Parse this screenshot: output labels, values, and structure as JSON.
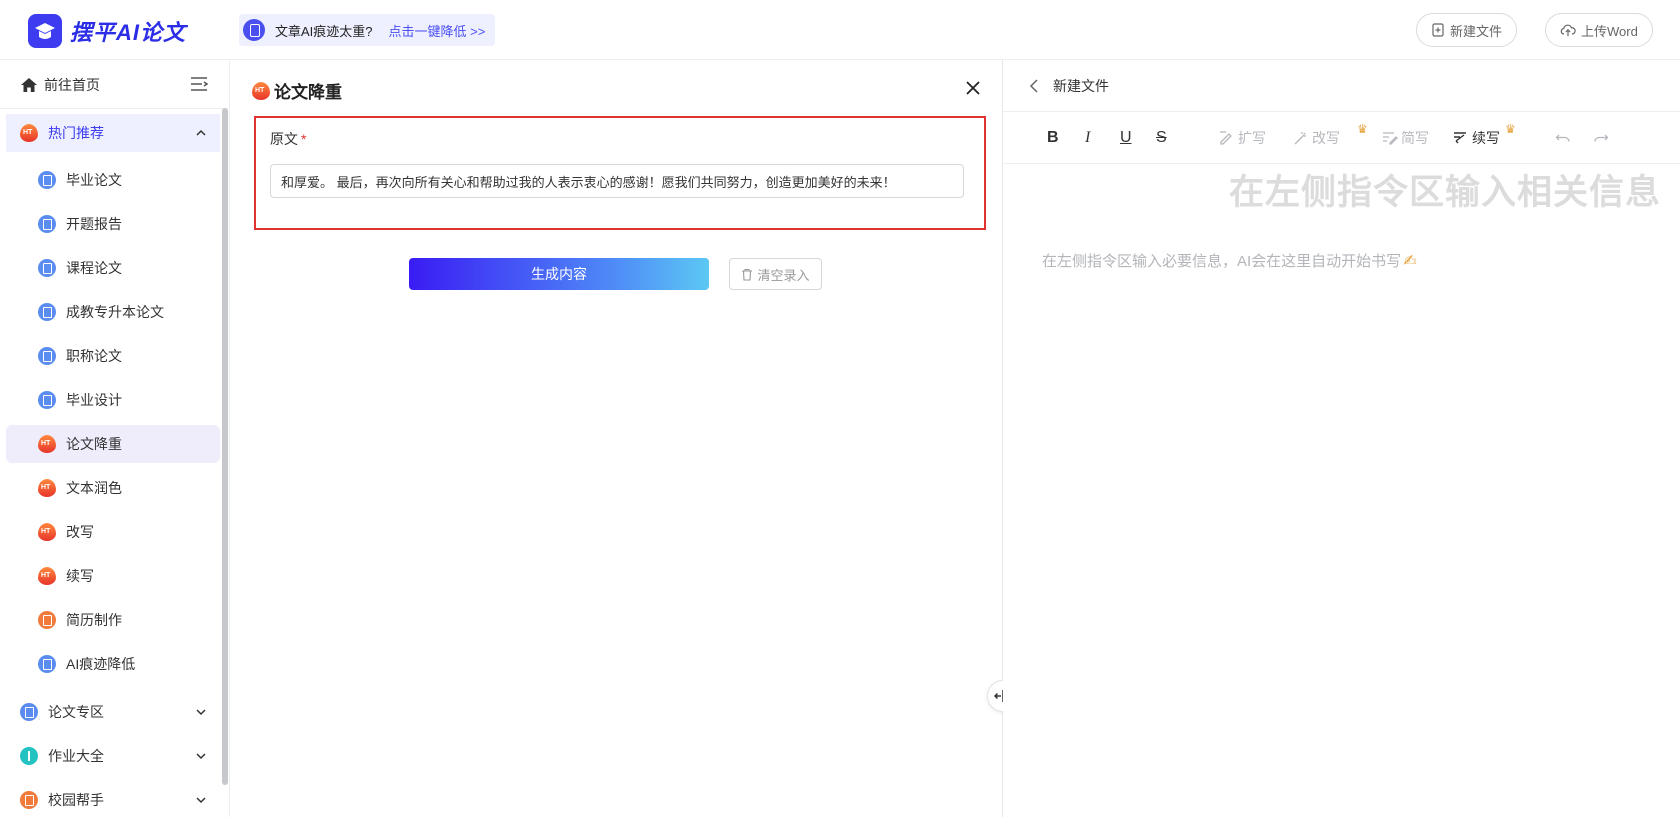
{
  "header": {
    "logo_text": "摆平AI论文",
    "promo_question": "文章AI痕迹太重?",
    "promo_link": "点击一键降低 >>",
    "new_file_label": "新建文件",
    "upload_word_label": "上传Word"
  },
  "sidebar": {
    "home_label": "前往首页",
    "hot_group_label": "热门推荐",
    "items": [
      {
        "label": "毕业论文",
        "icon": "doc-icon"
      },
      {
        "label": "开题报告",
        "icon": "doc-icon"
      },
      {
        "label": "课程论文",
        "icon": "doc-icon"
      },
      {
        "label": "成教专升本论文",
        "icon": "doc-icon"
      },
      {
        "label": "职称论文",
        "icon": "doc-icon"
      },
      {
        "label": "毕业设计",
        "icon": "doc-icon"
      },
      {
        "label": "论文降重",
        "icon": "fire-icon",
        "selected": true
      },
      {
        "label": "文本润色",
        "icon": "fire-icon"
      },
      {
        "label": "改写",
        "icon": "fire-icon"
      },
      {
        "label": "续写",
        "icon": "fire-icon"
      },
      {
        "label": "简历制作",
        "icon": "resume-icon"
      },
      {
        "label": "AI痕迹降低",
        "icon": "doc-icon"
      }
    ],
    "groups": [
      {
        "label": "论文专区"
      },
      {
        "label": "作业大全"
      },
      {
        "label": "校园帮手"
      }
    ]
  },
  "form": {
    "title": "论文降重",
    "field_label": "原文",
    "required_mark": "*",
    "input_value": "和厚爱。 最后，再次向所有关心和帮助过我的人表示衷心的感谢！愿我们共同努力，创造更加美好的未来！",
    "generate_label": "生成内容",
    "clear_label": "清空录入"
  },
  "editor": {
    "file_title": "新建文件",
    "tools": {
      "bold": "B",
      "italic": "I",
      "underline": "U",
      "strike": "S",
      "expand": "扩写",
      "rewrite": "改写",
      "simplify": "简写",
      "continue": "续写"
    },
    "watermark": "在左侧指令区输入相关信息",
    "placeholder": "在左侧指令区输入必要信息，AI会在这里自动开始书写",
    "accent_color": "#3d3cf0",
    "error_color": "#e0322f"
  }
}
